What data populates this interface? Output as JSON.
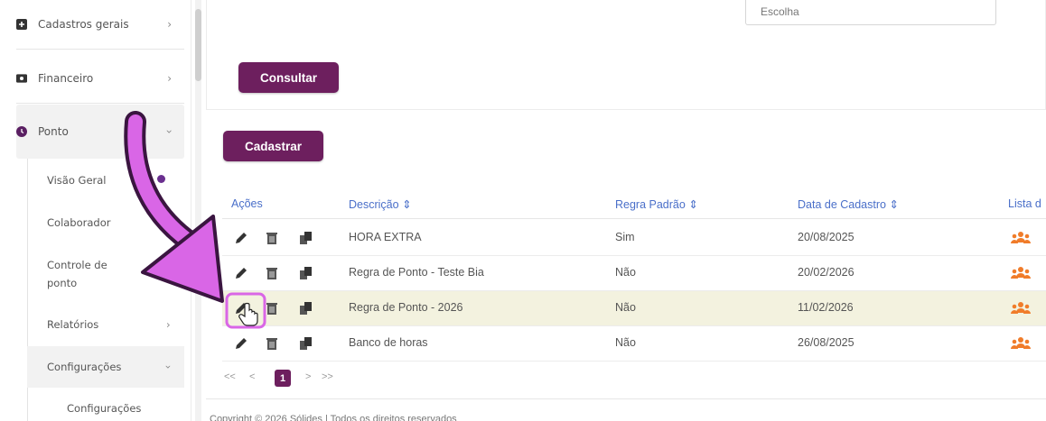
{
  "sidebar": {
    "items": [
      {
        "label": "Cadastros gerais",
        "icon": "plus-square-icon"
      },
      {
        "label": "Financeiro",
        "icon": "money-icon"
      },
      {
        "label": "Ponto",
        "icon": "clock-icon"
      }
    ],
    "ponto_submenu": [
      {
        "label": "Visão Geral"
      },
      {
        "label": "Colaborador"
      },
      {
        "label": "Controle de ponto"
      },
      {
        "label": "Relatórios"
      },
      {
        "label": "Configurações"
      }
    ],
    "configuracoes_submenu": [
      {
        "label": "Configurações"
      }
    ]
  },
  "filter": {
    "select_value": "Escolha",
    "consultar_label": "Consultar"
  },
  "cadastrar_label": "Cadastrar",
  "table": {
    "headers": [
      "Ações",
      "Descrição",
      "Regra Padrão",
      "Data de Cadastro",
      "Lista d"
    ],
    "rows": [
      {
        "descricao": "HORA EXTRA",
        "regra_padrao": "Sim",
        "data_cadastro": "20/08/2025"
      },
      {
        "descricao": "Regra de Ponto - Teste Bia",
        "regra_padrao": "Não",
        "data_cadastro": "20/02/2026"
      },
      {
        "descricao": "Regra de Ponto - 2026",
        "regra_padrao": "Não",
        "data_cadastro": "11/02/2026"
      },
      {
        "descricao": "Banco de horas",
        "regra_padrao": "Não",
        "data_cadastro": "26/08/2025"
      }
    ],
    "highlighted_row": 3
  },
  "pagination": {
    "first": "<<",
    "prev": "<",
    "current": "1",
    "next": ">",
    "last": ">>"
  },
  "footer": "Copyright © 2026 Sólides | Todos os direitos reservados",
  "colors": {
    "brand": "#6d1f5e",
    "header_link": "#4a6fc9",
    "highlight_row": "#f3f2df",
    "team_icon": "#f07c2a",
    "annotation": "#d966e6"
  }
}
